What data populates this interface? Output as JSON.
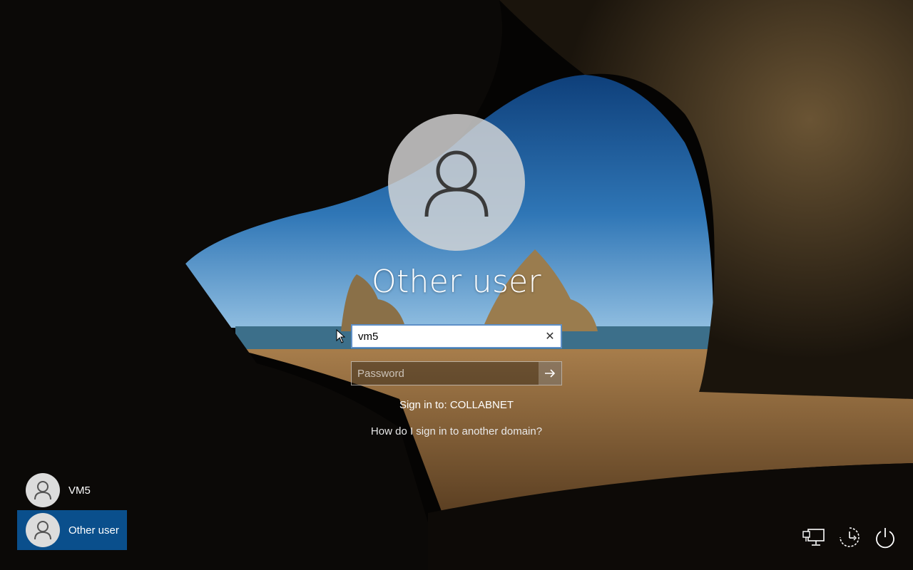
{
  "login": {
    "title": "Other user",
    "username_value": "vm5",
    "password_placeholder": "Password",
    "sign_in_to": "Sign in to: COLLABNET",
    "help_link": "How do I sign in to another domain?"
  },
  "user_list": [
    {
      "name": "VM5",
      "selected": false
    },
    {
      "name": "Other user",
      "selected": true
    }
  ],
  "icons": {
    "large_avatar": "user-icon",
    "clear": "close-icon",
    "submit": "arrow-right-icon",
    "network": "network-icon",
    "ease_of_access": "ease-of-access-icon",
    "power": "power-icon"
  },
  "colors": {
    "selected_user_bg": "#0a4f8c",
    "username_border": "#5e8fc7"
  }
}
